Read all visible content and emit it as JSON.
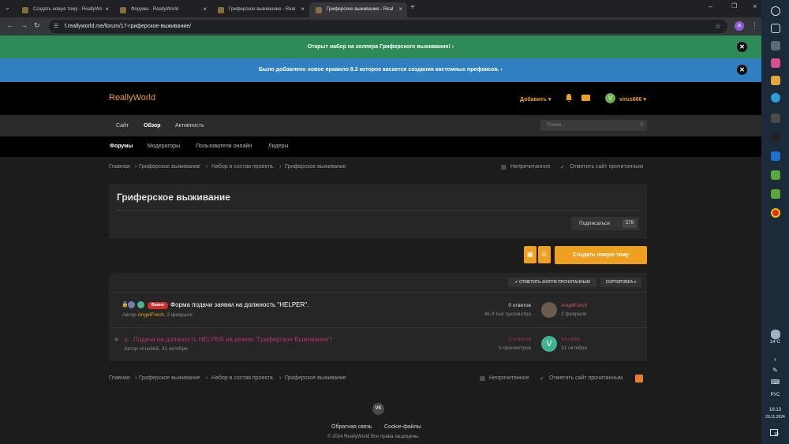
{
  "browser": {
    "tabs": [
      {
        "title": "Создать новую тему - ReallyWo"
      },
      {
        "title": "Форумы - ReallyWorld"
      },
      {
        "title": "Гриферское выживание - Real"
      },
      {
        "title": "Гриферское выживание - Real"
      }
    ],
    "active_tab": 3,
    "new_tab": "+",
    "url": "f.reallyworld.me/forum/17-гриферское-выживание/",
    "profile_initial": "a"
  },
  "banners": [
    {
      "text": "Открыт набор на хелпера Гриферского выживания!",
      "close": "✕",
      "color": "#2e8b57"
    },
    {
      "text": "Было добавлено новое правило 8.2 которое касается создания кастомных префиксов.",
      "close": "✕",
      "color": "#2f7fc1"
    }
  ],
  "header": {
    "logo": "ReallyWorld",
    "add_label": "Добавить ▾",
    "avatar_letter": "V",
    "username": "virus666 ▾",
    "accent": "#f0a020"
  },
  "nav_primary": {
    "items": [
      "Сайт",
      "Обзор",
      "Активность"
    ],
    "search_placeholder": "Поиск..."
  },
  "nav_secondary": {
    "items": [
      "Форумы",
      "Модераторы",
      "Пользователи онлайн",
      "Лидеры"
    ]
  },
  "breadcrumb": {
    "items": [
      "Главная",
      "›",
      "Гриферское выживание",
      "›",
      "Набор в состав проекта.",
      "›",
      "Гриферское выживание"
    ],
    "unread": "Непрочитанное",
    "mark_read": "Отметить сайт прочитанным"
  },
  "forum": {
    "title": "Гриферское выживание",
    "subscribe_label": "Подписаться",
    "subscribers": "579",
    "create_topic": "Создать новую тему",
    "mark_forum_read": "✔ ОТМЕТИТЬ ФОРУМ ПРОЧИТАННЫМ",
    "sort": "СОРТИРОВКА ▾"
  },
  "topics": [
    {
      "badge": "Важно",
      "title": "Форма подачи заявки на должность \"HELPER\".",
      "author_prefix": "Автор",
      "author": "AngelForch",
      "date": ", 2 февраля",
      "replies": "0 ответов",
      "views": "45.4 тыс просмотра",
      "last_user": "AngelForch",
      "last_date": "2 февраля"
    },
    {
      "title": "Подача на должность HELPER на режим \"Гриферское Выживание\"!",
      "author_line": "Автор virus666, 31 октября",
      "replies": "0 ответов",
      "views": "5 просмотров",
      "last_avatar": "V",
      "last_user": "virus666",
      "last_date": "31 октября"
    }
  ],
  "footer": {
    "vk": "VK",
    "feedback": "Обратная связь",
    "cookies": "Cookie-файлы",
    "copyright": "© 2024 ReallyWorld Все права защищены."
  },
  "taskbar": {
    "weather": "14°C",
    "lang": "РУС",
    "time": "16:13",
    "date": "29.11.2024",
    "notifications": "10"
  }
}
